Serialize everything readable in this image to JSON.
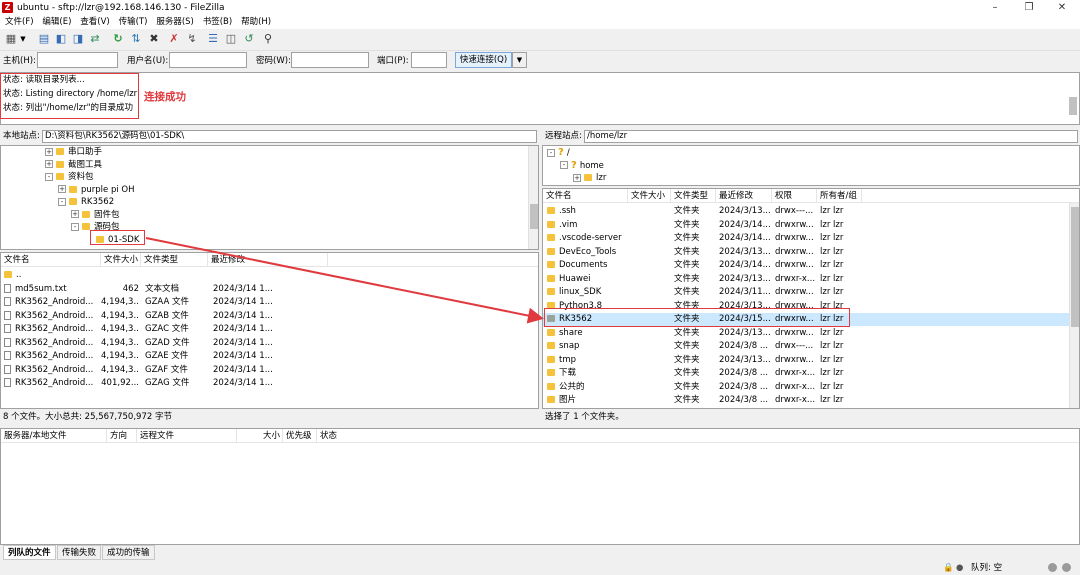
{
  "window": {
    "title": "ubuntu - sftp://lzr@192.168.146.130 - FileZilla",
    "app_icon": "filezilla-icon"
  },
  "menu": [
    "文件(F)",
    "编辑(E)",
    "查看(V)",
    "传输(T)",
    "服务器(S)",
    "书签(B)",
    "帮助(H)"
  ],
  "toolbar_icons": [
    "site-manager-icon",
    "dropdown-icon",
    "toggle-log-icon",
    "toggle-local-tree-icon",
    "toggle-remote-tree-icon",
    "toggle-queue-icon",
    "refresh-icon",
    "process-queue-icon",
    "cancel-icon",
    "disconnect-icon",
    "reconnect-icon",
    "filter-icon",
    "compare-icon",
    "sync-browse-icon",
    "search-icon"
  ],
  "quickconnect": {
    "host_label": "主机(H):",
    "user_label": "用户名(U):",
    "pass_label": "密码(W):",
    "port_label": "端口(P):",
    "button": "快速连接(Q)",
    "host": "",
    "user": "",
    "pass": "",
    "port": ""
  },
  "log": [
    {
      "label": "状态:",
      "text": "读取目录列表..."
    },
    {
      "label": "状态:",
      "text": "Listing directory /home/lzr"
    },
    {
      "label": "状态:",
      "text": "列出\"/home/lzr\"的目录成功"
    }
  ],
  "annotation": "连接成功",
  "local": {
    "site_label": "本地站点:",
    "path": "D:\\资料包\\RK3562\\源码包\\01-SDK\\",
    "tree": [
      {
        "label": "串口助手",
        "indent": 0,
        "exp": "+"
      },
      {
        "label": "截图工具",
        "indent": 0,
        "exp": "+"
      },
      {
        "label": "资料包",
        "indent": 0,
        "exp": "-"
      },
      {
        "label": "purple pi OH",
        "indent": 1,
        "exp": "+"
      },
      {
        "label": "RK3562",
        "indent": 1,
        "exp": "-"
      },
      {
        "label": "固件包",
        "indent": 2,
        "exp": "+"
      },
      {
        "label": "源码包",
        "indent": 2,
        "exp": "-"
      },
      {
        "label": "01-SDK",
        "indent": 3,
        "exp": ""
      }
    ],
    "headers": [
      "文件名",
      "文件大小",
      "文件类型",
      "最近修改"
    ],
    "files": [
      {
        "name": "..",
        "size": "",
        "type": "",
        "modified": "",
        "kind": "folder"
      },
      {
        "name": "md5sum.txt",
        "size": "462",
        "type": "文本文档",
        "modified": "2024/3/14 1...",
        "kind": "file"
      },
      {
        "name": "RK3562_Android...",
        "size": "4,194,3...",
        "type": "GZAA 文件",
        "modified": "2024/3/14 1...",
        "kind": "file"
      },
      {
        "name": "RK3562_Android...",
        "size": "4,194,3...",
        "type": "GZAB 文件",
        "modified": "2024/3/14 1...",
        "kind": "file"
      },
      {
        "name": "RK3562_Android...",
        "size": "4,194,3...",
        "type": "GZAC 文件",
        "modified": "2024/3/14 1...",
        "kind": "file"
      },
      {
        "name": "RK3562_Android...",
        "size": "4,194,3...",
        "type": "GZAD 文件",
        "modified": "2024/3/14 1...",
        "kind": "file"
      },
      {
        "name": "RK3562_Android...",
        "size": "4,194,3...",
        "type": "GZAE 文件",
        "modified": "2024/3/14 1...",
        "kind": "file"
      },
      {
        "name": "RK3562_Android...",
        "size": "4,194,3...",
        "type": "GZAF 文件",
        "modified": "2024/3/14 1...",
        "kind": "file"
      },
      {
        "name": "RK3562_Android...",
        "size": "401,92...",
        "type": "GZAG 文件",
        "modified": "2024/3/14 1...",
        "kind": "file"
      }
    ],
    "status": "8 个文件。大小总共: 25,567,750,972 字节"
  },
  "remote": {
    "site_label": "远程站点:",
    "path": "/home/lzr",
    "tree": [
      {
        "label": "/",
        "indent": 0,
        "exp": "-",
        "icon": "q"
      },
      {
        "label": "home",
        "indent": 1,
        "exp": "-",
        "icon": "q"
      },
      {
        "label": "lzr",
        "indent": 2,
        "exp": "+",
        "icon": "folder"
      }
    ],
    "headers": [
      "文件名",
      "文件大小",
      "文件类型",
      "最近修改",
      "权限",
      "所有者/组"
    ],
    "files": [
      {
        "name": ".ssh",
        "type": "文件夹",
        "modified": "2024/3/13...",
        "perm": "drwx---...",
        "owner": "lzr lzr"
      },
      {
        "name": ".vim",
        "type": "文件夹",
        "modified": "2024/3/14...",
        "perm": "drwxrw...",
        "owner": "lzr lzr"
      },
      {
        "name": ".vscode-server",
        "type": "文件夹",
        "modified": "2024/3/14...",
        "perm": "drwxrw...",
        "owner": "lzr lzr"
      },
      {
        "name": "DevEco_Tools",
        "type": "文件夹",
        "modified": "2024/3/13...",
        "perm": "drwxrw...",
        "owner": "lzr lzr"
      },
      {
        "name": "Documents",
        "type": "文件夹",
        "modified": "2024/3/14...",
        "perm": "drwxrw...",
        "owner": "lzr lzr"
      },
      {
        "name": "Huawei",
        "type": "文件夹",
        "modified": "2024/3/13...",
        "perm": "drwxr-x...",
        "owner": "lzr lzr"
      },
      {
        "name": "linux_SDK",
        "type": "文件夹",
        "modified": "2024/3/11...",
        "perm": "drwxrw...",
        "owner": "lzr lzr"
      },
      {
        "name": "Python3.8",
        "type": "文件夹",
        "modified": "2024/3/13...",
        "perm": "drwxrw...",
        "owner": "lzr lzr"
      },
      {
        "name": "RK3562",
        "type": "文件夹",
        "modified": "2024/3/15...",
        "perm": "drwxrw...",
        "owner": "lzr lzr",
        "selected": true
      },
      {
        "name": "share",
        "type": "文件夹",
        "modified": "2024/3/13...",
        "perm": "drwxrw...",
        "owner": "lzr lzr"
      },
      {
        "name": "snap",
        "type": "文件夹",
        "modified": "2024/3/8 ...",
        "perm": "drwx---...",
        "owner": "lzr lzr"
      },
      {
        "name": "tmp",
        "type": "文件夹",
        "modified": "2024/3/13...",
        "perm": "drwxrw...",
        "owner": "lzr lzr"
      },
      {
        "name": "下载",
        "type": "文件夹",
        "modified": "2024/3/8 ...",
        "perm": "drwxr-x...",
        "owner": "lzr lzr"
      },
      {
        "name": "公共的",
        "type": "文件夹",
        "modified": "2024/3/8 ...",
        "perm": "drwxr-x...",
        "owner": "lzr lzr"
      },
      {
        "name": "图片",
        "type": "文件夹",
        "modified": "2024/3/8 ...",
        "perm": "drwxr-x...",
        "owner": "lzr lzr"
      }
    ],
    "status": "选择了 1 个文件夹。"
  },
  "queue": {
    "headers": [
      "服务器/本地文件",
      "方向",
      "远程文件",
      "大小",
      "优先级",
      "状态"
    ]
  },
  "tabs": [
    "列队的文件",
    "传输失败",
    "成功的传输"
  ],
  "statusbar": {
    "queue": "队列: 空"
  },
  "colors": {
    "annotation": "#e0393e",
    "folder": "#f5c23b",
    "selection": "#cce8ff"
  }
}
